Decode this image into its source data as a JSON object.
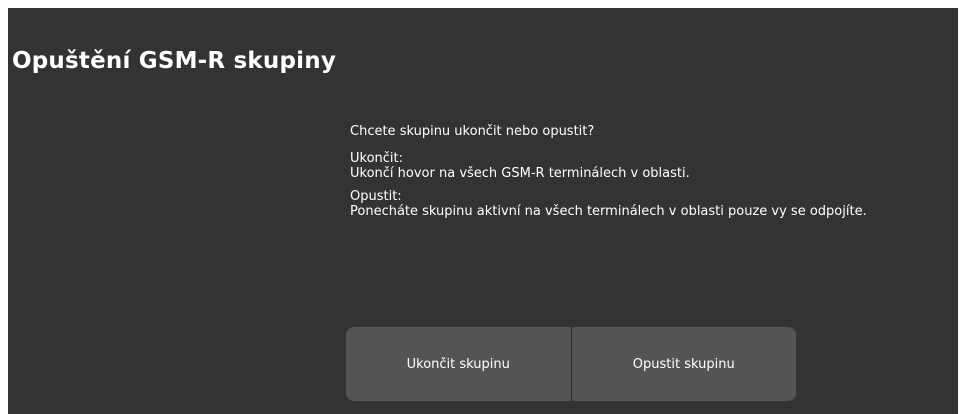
{
  "dialog": {
    "title": "Opuštění GSM-R skupiny",
    "question": "Chcete skupinu ukončit nebo opustit?",
    "end_heading": "Ukončit:",
    "end_description": "Ukončí hovor na všech GSM-R terminálech v oblasti.",
    "leave_heading": "Opustit:",
    "leave_description": "Ponecháte skupinu aktivní na všech terminálech v oblasti pouze vy se odpojíte."
  },
  "actions": {
    "end_group_label": "Ukončit skupinu",
    "leave_group_label": "Opustit skupinu"
  },
  "colors": {
    "dialog_background": "#333333",
    "button_background": "#545454",
    "text": "#ffffff"
  }
}
